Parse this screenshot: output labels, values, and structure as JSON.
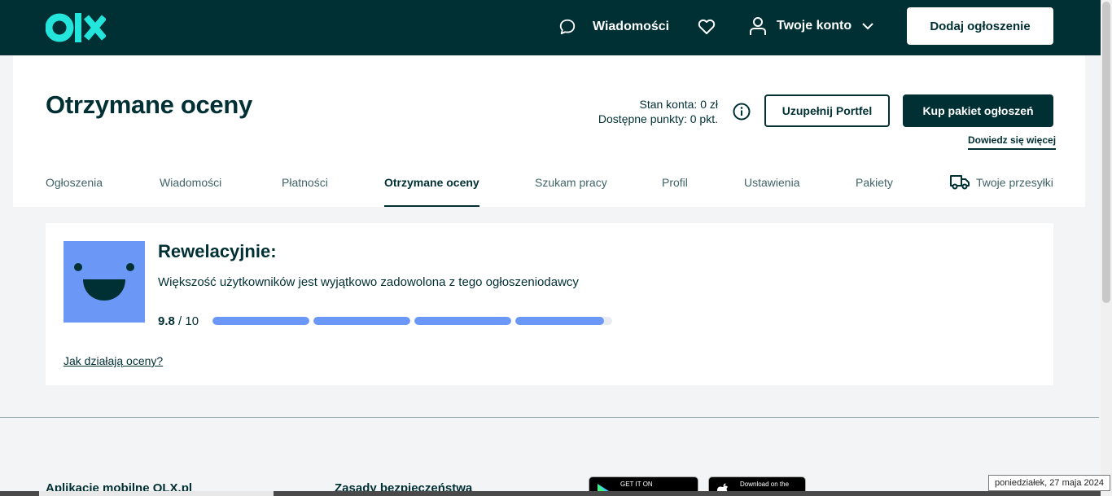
{
  "header": {
    "logo": "olx",
    "messages_label": "Wiadomości",
    "account_label": "Twoje konto",
    "add_listing_label": "Dodaj ogłoszenie"
  },
  "page": {
    "title": "Otrzymane oceny",
    "balance_label": "Stan konta: 0 zł",
    "points_label": "Dostępne punkty: 0 pkt.",
    "topup_label": "Uzupełnij Portfel",
    "buy_package_label": "Kup pakiet ogłoszeń",
    "learn_more_label": "Dowiedz się więcej"
  },
  "tabs": [
    {
      "label": "Ogłoszenia"
    },
    {
      "label": "Wiadomości"
    },
    {
      "label": "Płatności"
    },
    {
      "label": "Otrzymane oceny"
    },
    {
      "label": "Szukam pracy"
    },
    {
      "label": "Profil"
    },
    {
      "label": "Ustawienia"
    },
    {
      "label": "Pakiety"
    },
    {
      "label": "Twoje przesyłki"
    }
  ],
  "rating": {
    "title": "Rewelacyjnie:",
    "description": "Większość użytkowników jest wyjątkowo zadowolona z tego ogłoszeniodawcy",
    "score": "9.8",
    "score_max": "/ 10",
    "score_value": 9.8,
    "score_scale": 10,
    "how_link": "Jak działają oceny?"
  },
  "footer": {
    "apps_heading": "Aplikacje mobilne OLX.pl",
    "safety_heading": "Zasady bezpieczeństwa",
    "google_play_label": "GET IT ON",
    "app_store_label": "Download on the"
  },
  "taskbar": {
    "date": "poniedziałek, 27 maja 2024"
  },
  "colors": {
    "brand_dark": "#002f34",
    "logo_teal": "#23e5db",
    "rating_blue": "#6b98f6"
  }
}
